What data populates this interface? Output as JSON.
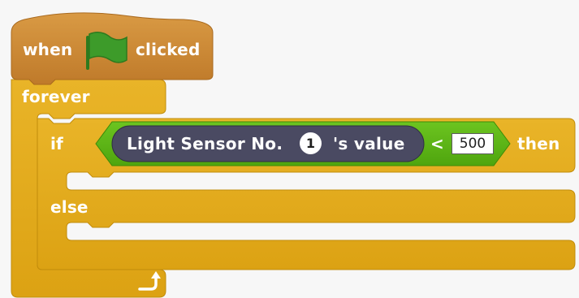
{
  "script": {
    "hat_block": {
      "prefix": "when",
      "suffix": "clicked",
      "icon": "green-flag-icon"
    },
    "forever_block": {
      "label": "forever",
      "loop_icon": "loop-arrow-icon"
    },
    "if_else_block": {
      "if_label": "if",
      "then_label": "then",
      "else_label": "else"
    },
    "condition": {
      "operator": "<",
      "threshold": "500",
      "sensor": {
        "label_prefix": "Light Sensor No.",
        "port": "1",
        "label_suffix": "'s value"
      }
    }
  },
  "colors": {
    "event_block": "#c88330",
    "control_block": "#e1a91a",
    "operator_block": "#5cb712",
    "sensor_reporter": "#4a4a62",
    "flag": "#3d9b2a",
    "label_text": "#ffffff"
  }
}
